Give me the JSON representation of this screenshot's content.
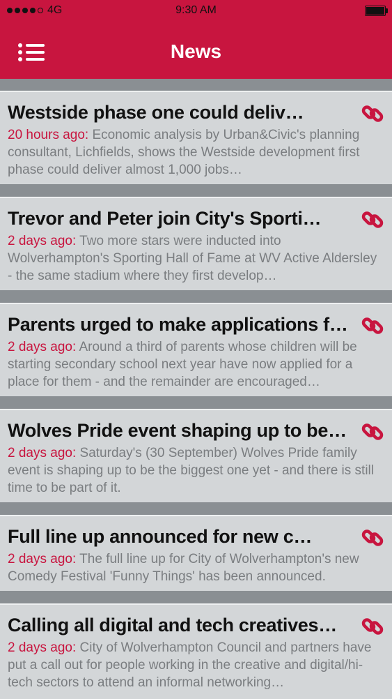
{
  "status_bar": {
    "carrier": "4G",
    "time": "9:30 AM"
  },
  "header": {
    "title": "News",
    "menu_icon": "list-icon"
  },
  "articles": [
    {
      "headline": "Westside phase one could deliv…",
      "time": "20 hours ago:",
      "summary": " Economic analysis by Urban&Civic's planning consultant, Lichfields, shows the Westside development first phase could deliver almost 1,000 jobs…"
    },
    {
      "headline": "Trevor and Peter join City's Sporti…",
      "time": "2 days ago:",
      "summary": " Two more stars were inducted into Wolverhampton's Sporting Hall of Fame at WV Active Aldersley - the same stadium where they first develop…"
    },
    {
      "headline": "Parents urged to make applications f…",
      "time": "2 days ago:",
      "summary": " Around a third of parents whose children will be starting secondary school next year have now applied for a place for them - and the remainder are encouraged…"
    },
    {
      "headline": "Wolves Pride event shaping up to be…",
      "time": "2 days ago:",
      "summary": " Saturday's (30 September) Wolves Pride family event is shaping up to be the biggest one yet - and there is still time to be part of it."
    },
    {
      "headline": "Full line up announced for new c…",
      "time": "2 days ago:",
      "summary": " The full line up for City of Wolverhampton's new Comedy Festival 'Funny Things' has been announced."
    },
    {
      "headline": "Calling all digital and tech creatives…",
      "time": "2 days ago:",
      "summary": " City of Wolverhampton Council and partners have put a call out for people working in the creative and digital/hi-tech sectors to attend an informal networking…"
    }
  ],
  "colors": {
    "accent": "#c8153f",
    "card": "#d3d6d8",
    "separator": "#8a8f93"
  },
  "icons": {
    "article_link": "link-icon"
  }
}
